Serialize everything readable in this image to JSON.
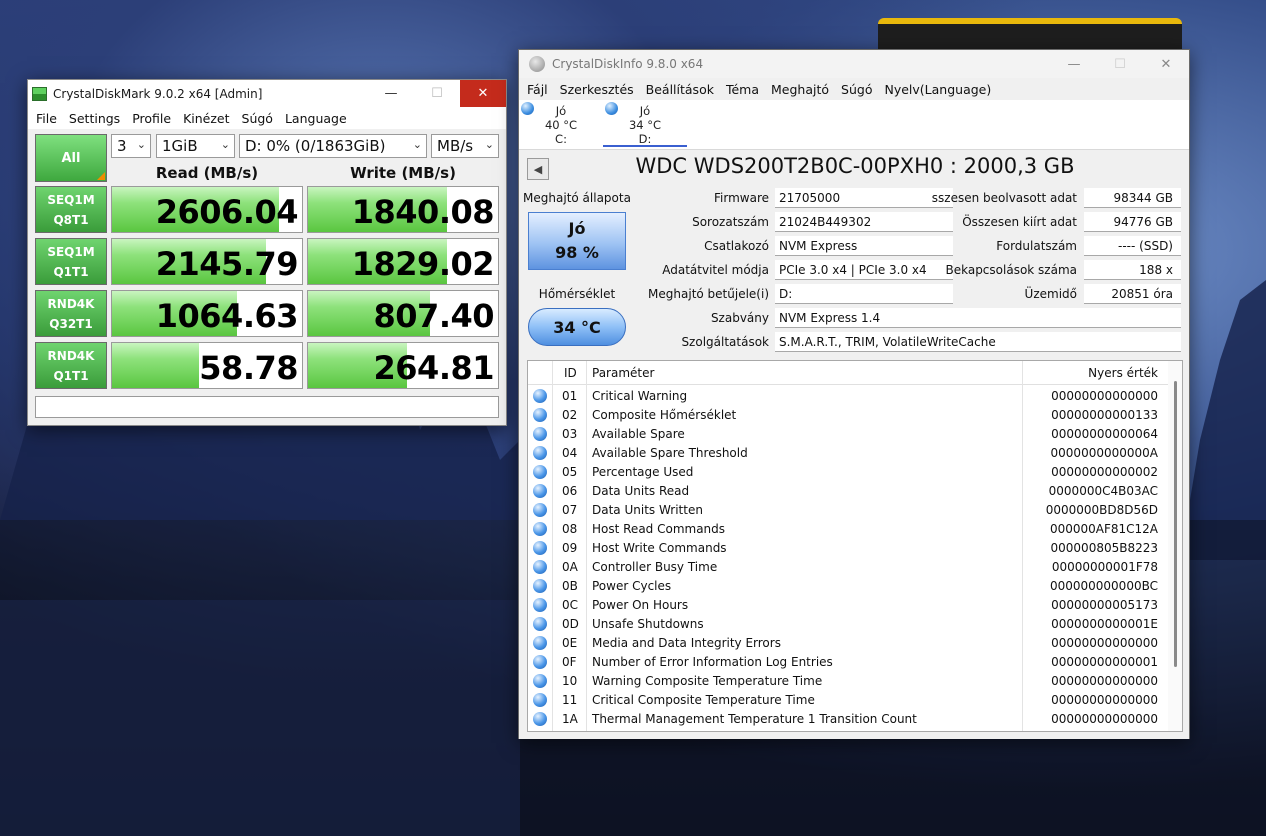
{
  "cdm": {
    "title": "CrystalDiskMark 9.0.2 x64 [Admin]",
    "menu": [
      "File",
      "Settings",
      "Profile",
      "Kinézet",
      "Súgó",
      "Language"
    ],
    "all_label": "All",
    "count": "3",
    "size": "1GiB",
    "drive": "D: 0% (0/1863GiB)",
    "unit": "MB/s",
    "read_header": "Read (MB/s)",
    "write_header": "Write (MB/s)",
    "tests": [
      {
        "l1": "SEQ1M",
        "l2": "Q8T1",
        "read": "2606.04",
        "write": "1840.08",
        "read_fill": 0.88,
        "write_fill": 0.73
      },
      {
        "l1": "SEQ1M",
        "l2": "Q1T1",
        "read": "2145.79",
        "write": "1829.02",
        "read_fill": 0.81,
        "write_fill": 0.73
      },
      {
        "l1": "RND4K",
        "l2": "Q32T1",
        "read": "1064.63",
        "write": "807.40",
        "read_fill": 0.66,
        "write_fill": 0.64
      },
      {
        "l1": "RND4K",
        "l2": "Q1T1",
        "read": "58.78",
        "write": "264.81",
        "read_fill": 0.46,
        "write_fill": 0.52
      }
    ]
  },
  "cdi": {
    "title": "CrystalDiskInfo 9.8.0 x64",
    "menu": [
      "Fájl",
      "Szerkesztés",
      "Beállítások",
      "Téma",
      "Meghajtó",
      "Súgó",
      "Nyelv(Language)"
    ],
    "drives": [
      {
        "status": "Jó",
        "temp": "40 °C",
        "letter": "C:"
      },
      {
        "status": "Jó",
        "temp": "34 °C",
        "letter": "D:"
      }
    ],
    "model": "WDC WDS200T2B0C-00PXH0 : 2000,3 GB",
    "health_label": "Meghajtó állapota",
    "health_status": "Jó",
    "health_pct": "98 %",
    "temp_label": "Hőmérséklet",
    "temp_value": "34 °C",
    "firmware_label": "Firmware",
    "firmware": "21705000",
    "serial_label": "Sorozatszám",
    "serial": "21024B449302",
    "interface_label": "Csatlakozó",
    "interface": "NVM Express",
    "transfer_label": "Adatátvitel módja",
    "transfer": "PCIe 3.0 x4 | PCIe 3.0 x4",
    "letter_label": "Meghajtó betűjele(i)",
    "letter": "D:",
    "standard_label": "Szabvány",
    "standard": "NVM Express 1.4",
    "features_label": "Szolgáltatások",
    "features": "S.M.A.R.T., TRIM, VolatileWriteCache",
    "host_reads_label": "sszesen beolvasott adat",
    "host_reads": "98344 GB",
    "host_writes_label": "Összesen kiírt adat",
    "host_writes": "94776 GB",
    "rotation_label": "Fordulatszám",
    "rotation": "---- (SSD)",
    "power_count_label": "Bekapcsolások száma",
    "power_count": "188 x",
    "power_hours_label": "Üzemidő",
    "power_hours": "20851 óra",
    "smart_headers": {
      "id": "ID",
      "param": "Paraméter",
      "raw": "Nyers érték"
    },
    "smart": [
      {
        "id": "01",
        "param": "Critical Warning",
        "raw": "00000000000000"
      },
      {
        "id": "02",
        "param": "Composite Hőmérséklet",
        "raw": "00000000000133"
      },
      {
        "id": "03",
        "param": "Available Spare",
        "raw": "00000000000064"
      },
      {
        "id": "04",
        "param": "Available Spare Threshold",
        "raw": "0000000000000A"
      },
      {
        "id": "05",
        "param": "Percentage Used",
        "raw": "00000000000002"
      },
      {
        "id": "06",
        "param": "Data Units Read",
        "raw": "0000000C4B03AC"
      },
      {
        "id": "07",
        "param": "Data Units Written",
        "raw": "0000000BD8D56D"
      },
      {
        "id": "08",
        "param": "Host Read Commands",
        "raw": "000000AF81C12A"
      },
      {
        "id": "09",
        "param": "Host Write Commands",
        "raw": "000000805B8223"
      },
      {
        "id": "0A",
        "param": "Controller Busy Time",
        "raw": "00000000001F78"
      },
      {
        "id": "0B",
        "param": "Power Cycles",
        "raw": "000000000000BC"
      },
      {
        "id": "0C",
        "param": "Power On Hours",
        "raw": "00000000005173"
      },
      {
        "id": "0D",
        "param": "Unsafe Shutdowns",
        "raw": "0000000000001E"
      },
      {
        "id": "0E",
        "param": "Media and Data Integrity Errors",
        "raw": "00000000000000"
      },
      {
        "id": "0F",
        "param": "Number of Error Information Log Entries",
        "raw": "00000000000001"
      },
      {
        "id": "10",
        "param": "Warning Composite Temperature Time",
        "raw": "00000000000000"
      },
      {
        "id": "11",
        "param": "Critical Composite Temperature Time",
        "raw": "00000000000000"
      },
      {
        "id": "1A",
        "param": "Thermal Management Temperature 1 Transition Count",
        "raw": "00000000000000"
      }
    ]
  }
}
